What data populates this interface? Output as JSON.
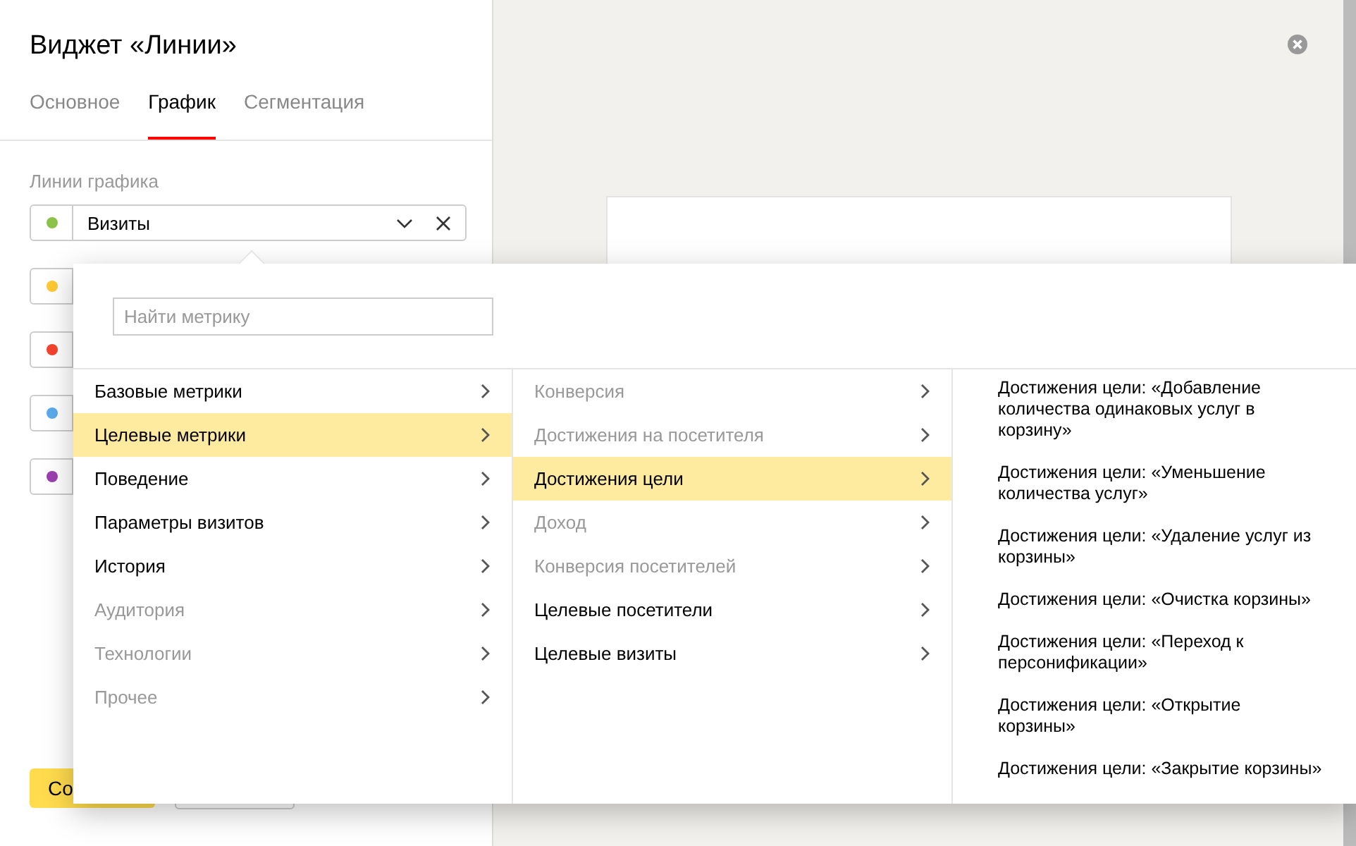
{
  "panel": {
    "title": "Виджет «Линии»",
    "tabs": [
      {
        "label": "Основное",
        "selected": false
      },
      {
        "label": "График",
        "selected": true
      },
      {
        "label": "Сегментация",
        "selected": false
      }
    ],
    "lines_label": "Линии графика",
    "lines": [
      {
        "color": "#8bc34a",
        "value": "Визиты"
      },
      {
        "color": "#ffc933"
      },
      {
        "color": "#f4432c"
      },
      {
        "color": "#5aaaeb"
      },
      {
        "color": "#9c3fb0"
      }
    ],
    "save_button": "Со"
  },
  "metric_picker": {
    "search": {
      "placeholder": "Найти метрику"
    },
    "groups": [
      {
        "label": "Базовые метрики",
        "disabled": false,
        "selected": false
      },
      {
        "label": "Целевые метрики",
        "disabled": false,
        "selected": true
      },
      {
        "label": "Поведение",
        "disabled": false,
        "selected": false
      },
      {
        "label": "Параметры визитов",
        "disabled": false,
        "selected": false
      },
      {
        "label": "История",
        "disabled": false,
        "selected": false
      },
      {
        "label": "Аудитория",
        "disabled": true,
        "selected": false
      },
      {
        "label": "Технологии",
        "disabled": true,
        "selected": false
      },
      {
        "label": "Прочее",
        "disabled": true,
        "selected": false
      }
    ],
    "subgroups": [
      {
        "label": "Конверсия",
        "disabled": true,
        "selected": false
      },
      {
        "label": "Достижения на посетителя",
        "disabled": true,
        "selected": false
      },
      {
        "label": "Достижения цели",
        "disabled": false,
        "selected": true
      },
      {
        "label": "Доход",
        "disabled": true,
        "selected": false
      },
      {
        "label": "Конверсия посетителей",
        "disabled": true,
        "selected": false
      },
      {
        "label": "Целевые посетители",
        "disabled": false,
        "selected": false
      },
      {
        "label": "Целевые визиты",
        "disabled": false,
        "selected": false
      }
    ],
    "metrics": [
      "Достижения цели: «Добавление количества одинаковых услуг в корзину»",
      "Достижения цели: «Уменьшение количества услуг»",
      "Достижения цели: «Удаление услуг из корзины»",
      "Достижения цели: «Очистка корзины»",
      "Достижения цели: «Переход к персонификации»",
      "Достижения цели: «Открытие корзины»",
      "Достижения цели: «Закрытие корзины»"
    ]
  }
}
